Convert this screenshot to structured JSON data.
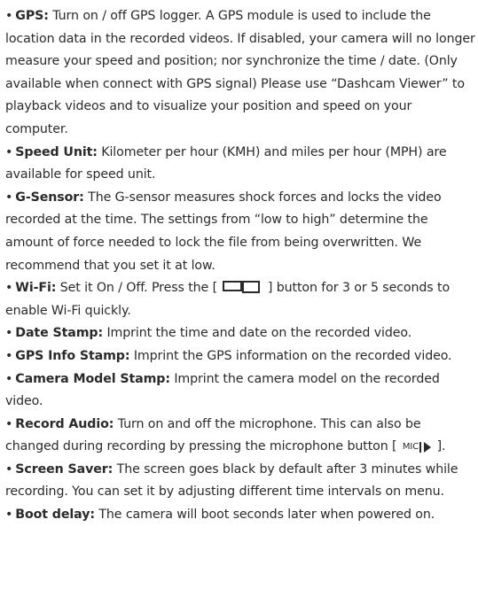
{
  "items": [
    {
      "term": "GPS:",
      "text": " Turn on / off GPS logger. A GPS module is used to include the location data in the recorded videos. If disabled, your camera will no longer measure your speed and position; nor synchronize the time / date. (Only available when connect with GPS signal) Please use “Dashcam Viewer” to playback videos and to visualize your position and speed on your computer."
    },
    {
      "term": "Speed Unit:",
      "text": " Kilometer per hour (KMH) and miles per hour (MPH) are available for speed unit."
    },
    {
      "term": "G-Sensor:",
      "text": " The G-sensor measures shock forces and locks the video recorded at the time. The settings from “low to high” determine the amount of force needed to lock the file from being overwritten. We recommend that you set it at low."
    },
    {
      "term": "Wi-Fi:",
      "text_before": " Set it On / Off. Press the [ ",
      "icon": "camera-mode-icon",
      "text_after": " ] button for 3 or 5 seconds to enable Wi-Fi quickly."
    },
    {
      "term": "Date Stamp:",
      "text": " Imprint the time and date on the recorded video."
    },
    {
      "term": "GPS Info Stamp:",
      "text": " Imprint the GPS information on the recorded video."
    },
    {
      "term": "Camera Model Stamp:",
      "text": " Imprint the camera model on the recorded video."
    },
    {
      "term": "Record Audio:",
      "text_before": " Turn on and off the microphone. This can also be changed during recording by pressing the microphone button [ ",
      "icon": "mic-play-icon",
      "icon_label": "MIC",
      "text_after": " ]."
    },
    {
      "term": "Screen Saver:",
      "text": " The screen goes black by default after 3 minutes while recording. You can set it by adjusting different time intervals on menu."
    },
    {
      "term": "Boot delay:",
      "text": " The camera will boot seconds later when powered on."
    }
  ],
  "bullet": "•"
}
